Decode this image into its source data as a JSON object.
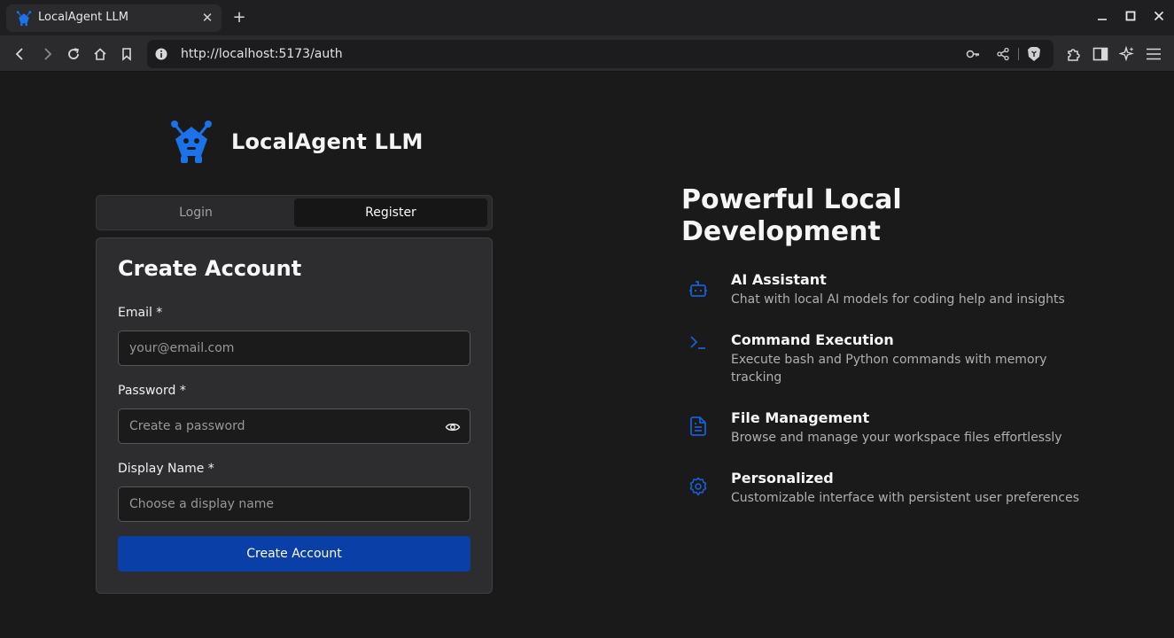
{
  "browser": {
    "tab_title": "LocalAgent LLM",
    "tab_close": "✕",
    "new_tab": "+",
    "url": "http://localhost:5173/auth",
    "window_controls": {
      "minimize": "–",
      "maximize": "□",
      "close": "✕"
    },
    "icons": [
      "back-icon",
      "forward-icon",
      "reload-icon",
      "home-icon",
      "bookmark-icon",
      "site-info-icon",
      "key-icon",
      "share-icon",
      "brave-shield-icon",
      "extensions-icon",
      "sidebar-icon",
      "leo-ai-icon",
      "menu-icon"
    ]
  },
  "brand": {
    "name": "LocalAgent LLM",
    "accent": "#1a73e8"
  },
  "auth_tabs": {
    "login": "Login",
    "register": "Register",
    "active": "register"
  },
  "form": {
    "title": "Create Account",
    "email_label": "Email *",
    "email_placeholder": "your@email.com",
    "password_label": "Password *",
    "password_placeholder": "Create a password",
    "display_name_label": "Display Name *",
    "display_name_placeholder": "Choose a display name",
    "submit_label": "Create Account",
    "submit_color": "#0a3fa8"
  },
  "promo": {
    "title": "Powerful Local Development",
    "features": [
      {
        "icon": "bot-icon",
        "title": "AI Assistant",
        "description": "Chat with local AI models for coding help and insights"
      },
      {
        "icon": "terminal-icon",
        "title": "Command Execution",
        "description": "Execute bash and Python commands with memory tracking"
      },
      {
        "icon": "file-icon",
        "title": "File Management",
        "description": "Browse and manage your workspace files effortlessly"
      },
      {
        "icon": "settings-gear-icon",
        "title": "Personalized",
        "description": "Customizable interface with persistent user preferences"
      }
    ]
  }
}
